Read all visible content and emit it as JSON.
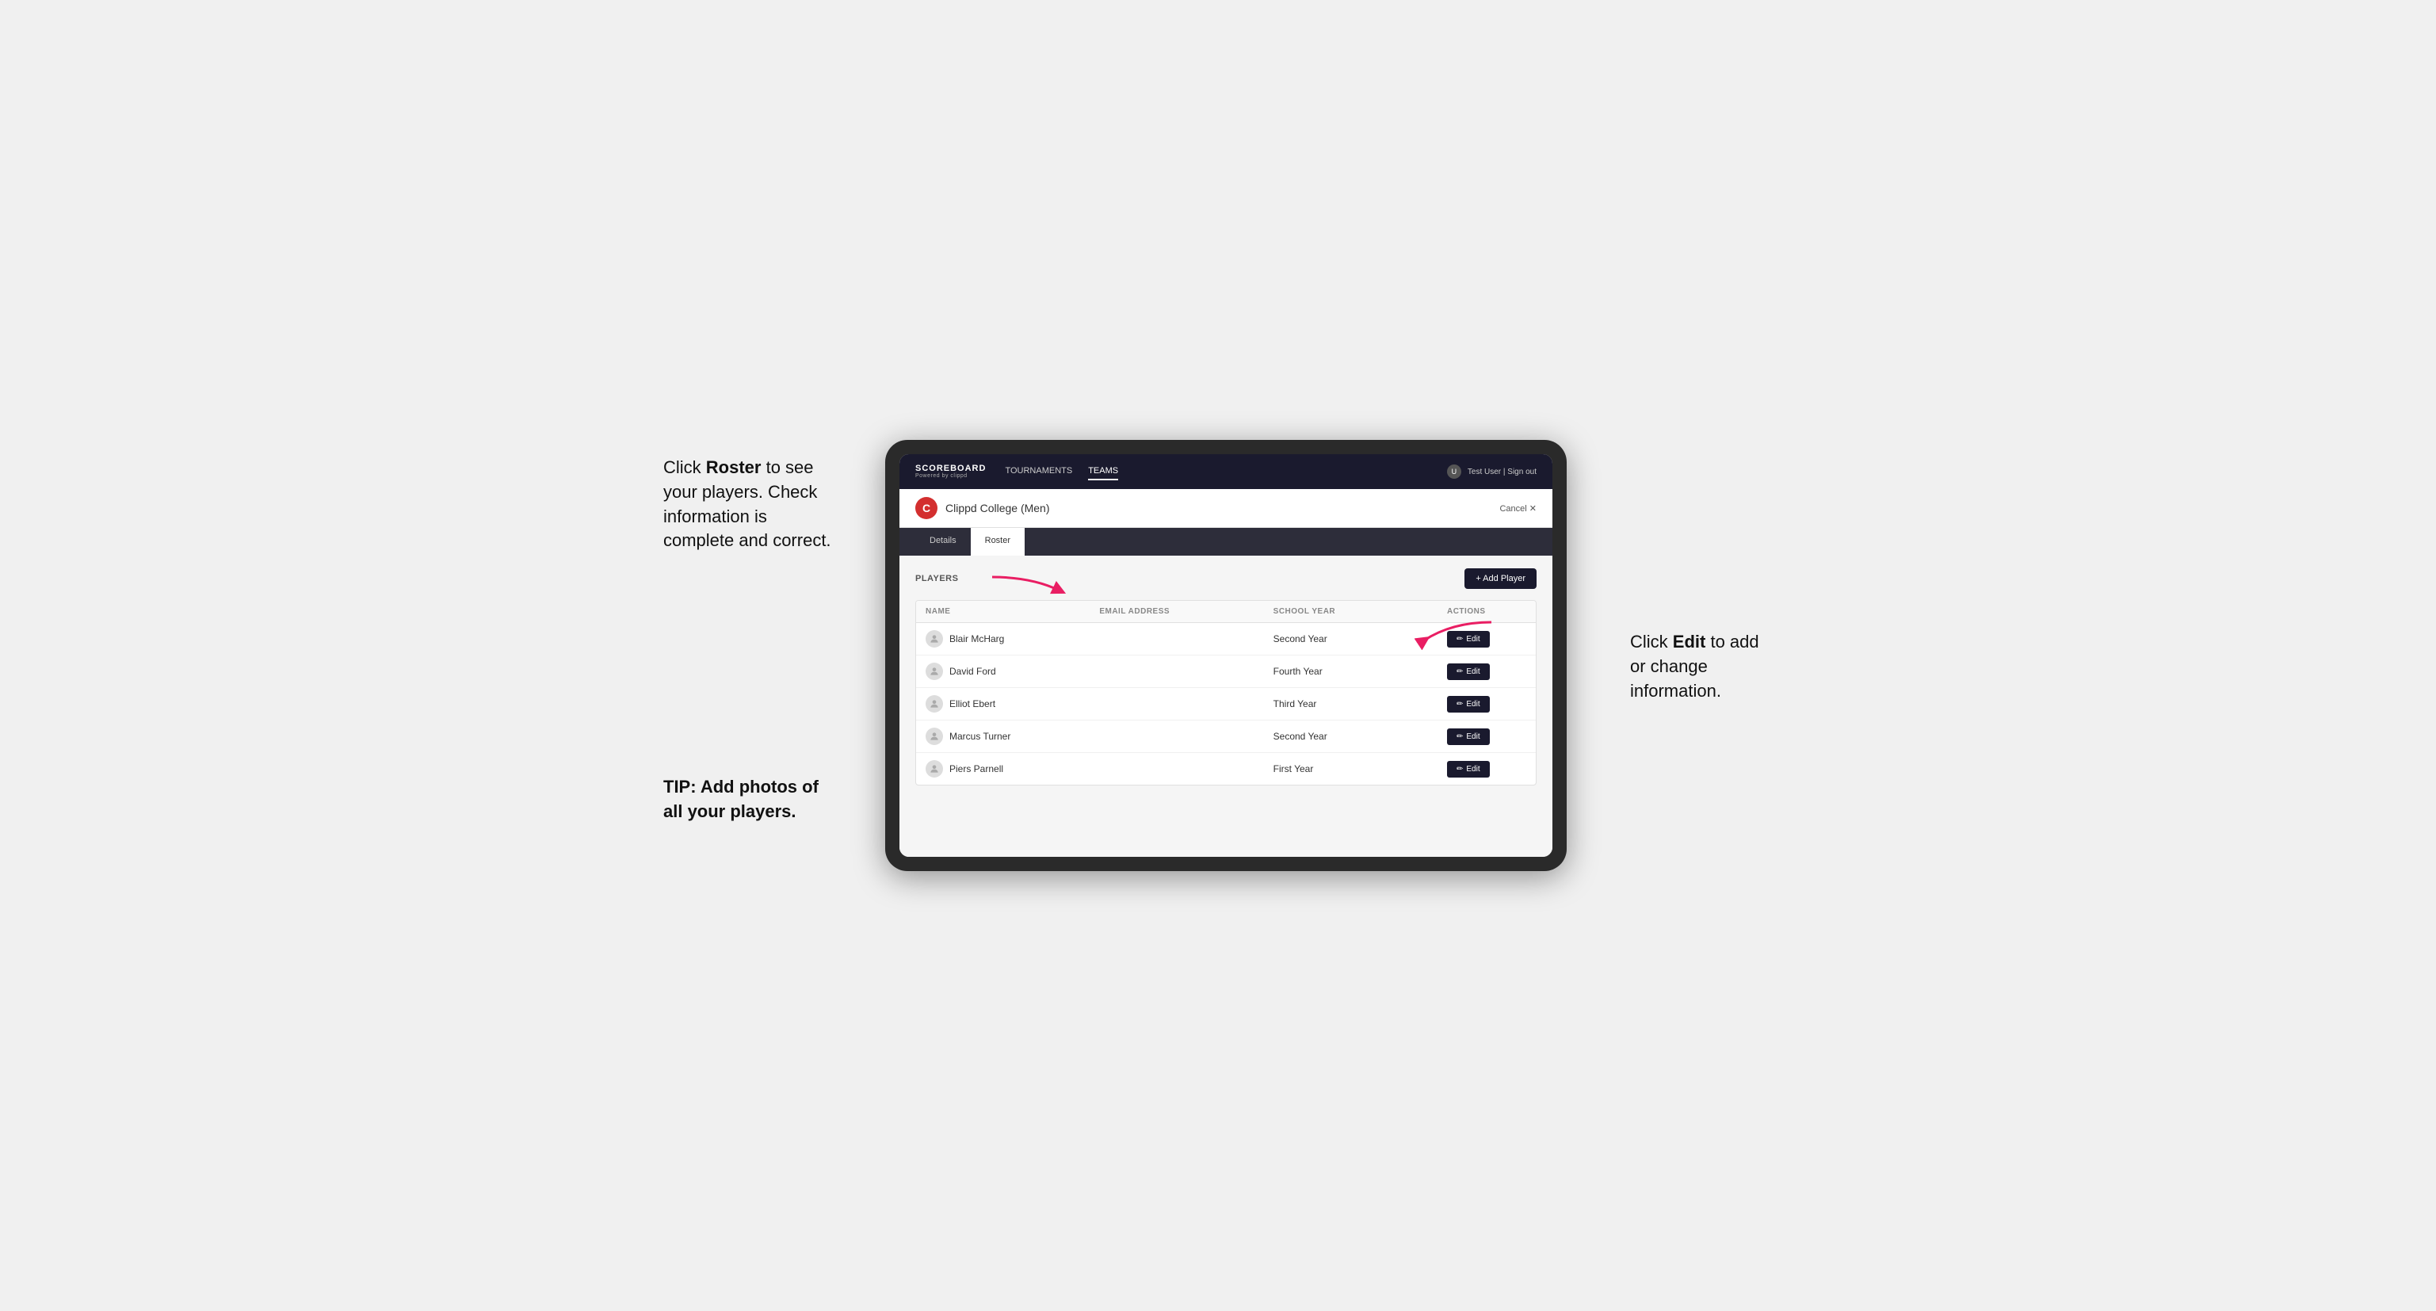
{
  "left_annotation": {
    "line1": "Click ",
    "bold1": "Roster",
    "line2": " to see your players. Check information is complete and correct.",
    "tip_label": "TIP: Add photos of all your players."
  },
  "right_annotation": {
    "line1": "Click ",
    "bold1": "Edit",
    "line2": " to add or change information."
  },
  "navbar": {
    "logo": "SCOREBOARD",
    "logo_sub": "Powered by clippd",
    "nav_items": [
      {
        "label": "TOURNAMENTS",
        "active": false
      },
      {
        "label": "TEAMS",
        "active": true
      }
    ],
    "user_label": "Test User | Sign out"
  },
  "team": {
    "logo_letter": "C",
    "name": "Clippd College (Men)",
    "cancel_label": "Cancel ✕"
  },
  "tabs": [
    {
      "label": "Details",
      "active": false
    },
    {
      "label": "Roster",
      "active": true
    }
  ],
  "players_section": {
    "label": "PLAYERS",
    "add_button": "+ Add Player"
  },
  "table": {
    "headers": [
      "NAME",
      "EMAIL ADDRESS",
      "SCHOOL YEAR",
      "ACTIONS"
    ],
    "rows": [
      {
        "name": "Blair McHarg",
        "email": "",
        "school_year": "Second Year",
        "action": "Edit"
      },
      {
        "name": "David Ford",
        "email": "",
        "school_year": "Fourth Year",
        "action": "Edit"
      },
      {
        "name": "Elliot Ebert",
        "email": "",
        "school_year": "Third Year",
        "action": "Edit"
      },
      {
        "name": "Marcus Turner",
        "email": "",
        "school_year": "Second Year",
        "action": "Edit"
      },
      {
        "name": "Piers Parnell",
        "email": "",
        "school_year": "First Year",
        "action": "Edit"
      }
    ]
  }
}
